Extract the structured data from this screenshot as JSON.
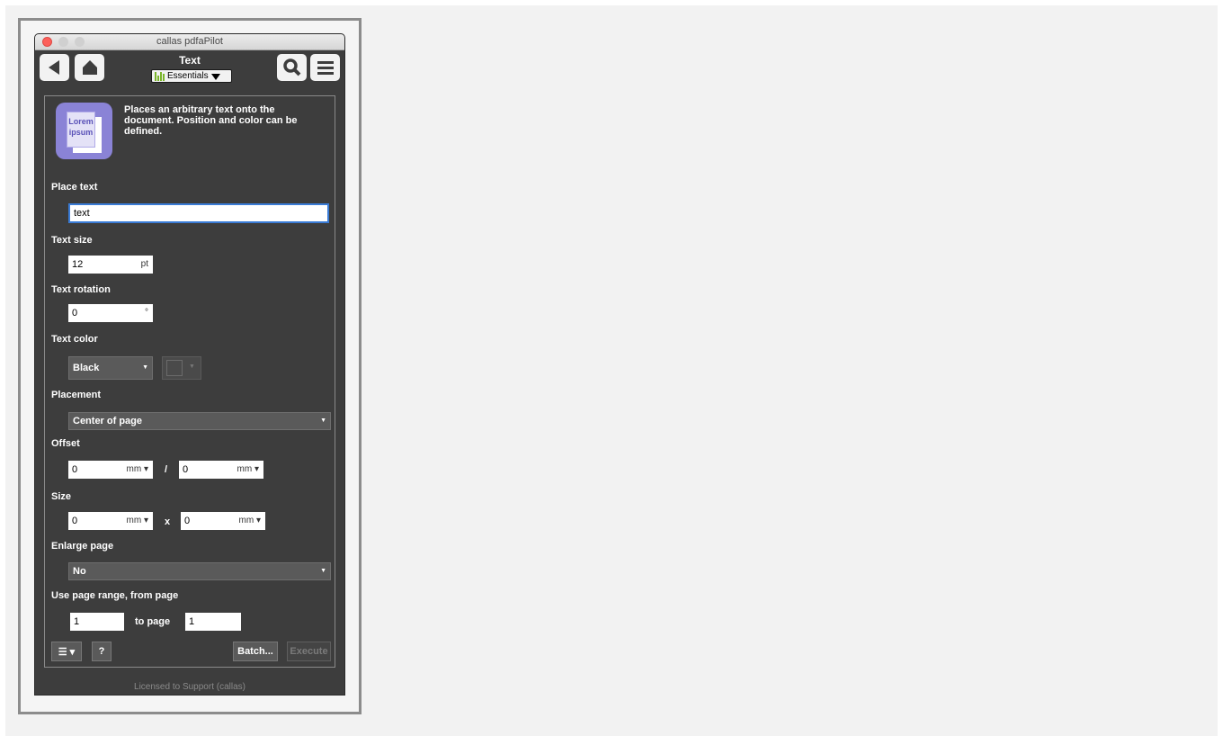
{
  "window": {
    "title": "callas pdfaPilot"
  },
  "header": {
    "title": "Text",
    "essentials_label": "Essentials",
    "back_icon": "back-arrow-icon",
    "home_icon": "home-icon",
    "search_icon": "search-icon",
    "menu_icon": "menu-icon"
  },
  "intro": {
    "icon_text_1": "Lorem",
    "icon_text_2": "ipsum",
    "description": "Places an arbitrary text onto the document. Position and color can be defined."
  },
  "form": {
    "place_text_label": "Place text",
    "place_text_value": "text",
    "text_size_label": "Text size",
    "text_size_value": "12",
    "text_size_unit": "pt",
    "text_rotation_label": "Text rotation",
    "text_rotation_value": "0",
    "text_rotation_unit": "°",
    "text_color_label": "Text color",
    "text_color_value": "Black",
    "placement_label": "Placement",
    "placement_value": "Center of page",
    "offset_label": "Offset",
    "offset_x": "0",
    "offset_x_unit": "mm",
    "offset_sep": "/",
    "offset_y": "0",
    "offset_y_unit": "mm",
    "size_label": "Size",
    "size_w": "0",
    "size_w_unit": "mm",
    "size_sep": "x",
    "size_h": "0",
    "size_h_unit": "mm",
    "enlarge_label": "Enlarge page",
    "enlarge_value": "No",
    "range_label": "Use page range, from page",
    "range_from": "1",
    "range_to_label": "to page",
    "range_to": "1"
  },
  "actions": {
    "menu_label": "☰ ▾",
    "help_label": "?",
    "batch_label": "Batch...",
    "execute_label": "Execute"
  },
  "footer": {
    "license": "Licensed to Support (callas)"
  },
  "colors": {
    "panel_bg": "#3d3d3d",
    "accent_blue": "#3a7bd5",
    "essentials_green": "#7ab52b"
  }
}
